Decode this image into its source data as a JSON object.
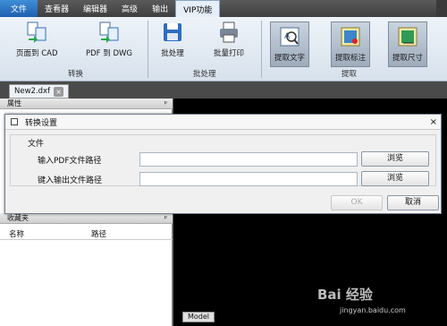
{
  "menubar": {
    "items": [
      "文件",
      "查看器",
      "编辑器",
      "高级",
      "输出",
      "VIP功能"
    ]
  },
  "ribbon": {
    "buttons": {
      "page_to_cad": "页面到 CAD",
      "pdf_to_dwg": "PDF 到 DWG",
      "batch_process": "批处理",
      "batch_print": "批量打印",
      "extract_text": "提取文字",
      "extract_annotation": "提取标注",
      "extract_size": "提取尺寸"
    },
    "groups": {
      "convert": "转换",
      "batch": "批处理",
      "extract": "提取"
    }
  },
  "doc_tab": {
    "label": "New2.dxf",
    "close": "×"
  },
  "left_panel": {
    "properties_title": "属性",
    "properties_peek": "数",
    "favorites_title": "收藏夹",
    "columns": {
      "name": "名称",
      "path": "路径"
    },
    "pin": "ᵖ"
  },
  "canvas": {
    "model_tab": "Model",
    "watermark": "Bai 经验",
    "watermark_url": "jingyan.baidu.com"
  },
  "dialog": {
    "title": "转换设置",
    "close": "×",
    "group": "文件",
    "input_pdf_label": "输入PDF文件路径",
    "output_label": "键入输出文件路径",
    "input_pdf_value": "",
    "output_value": "",
    "browse": "浏览",
    "ok": "OK",
    "cancel": "取消"
  }
}
